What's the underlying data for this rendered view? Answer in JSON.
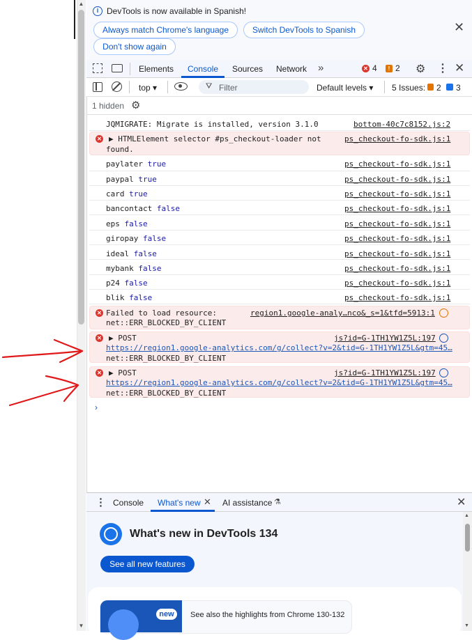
{
  "infobar": {
    "icon": "i",
    "message": "DevTools is now available in Spanish!",
    "btn_match": "Always match Chrome's language",
    "btn_switch": "Switch DevTools to Spanish",
    "btn_dont": "Don't show again",
    "close": "✕"
  },
  "tabs": {
    "elements": "Elements",
    "console": "Console",
    "sources": "Sources",
    "network": "Network",
    "more": "»",
    "error_icon": "✕",
    "error_count": "4",
    "warning_icon": "!",
    "warning_count": "2",
    "settings": "⚙",
    "menu": "⋮",
    "close": "✕"
  },
  "toolbar": {
    "context": "top ▾",
    "filter_icon": "⛛",
    "filter_placeholder": "Filter",
    "levels": "Default levels ▾",
    "issues_label": "5 Issues:",
    "issues_warn": "2",
    "issues_info": "3",
    "hidden": "1 hidden",
    "hidden_gear": "⚙"
  },
  "console_rows": [
    {
      "text": "JQMIGRATE: Migrate is installed, version 3.1.0",
      "source": "bottom-40c7c8152.js:2"
    },
    {
      "text": "▶ HTMLElement selector #ps_checkout-loader not",
      "text2": "found.",
      "source": "ps_checkout-fo-sdk.js:1"
    },
    {
      "text": "paylater",
      "value": "true",
      "source": "ps_checkout-fo-sdk.js:1"
    },
    {
      "text": "paypal",
      "value": "true",
      "source": "ps_checkout-fo-sdk.js:1"
    },
    {
      "text": "card",
      "value": "true",
      "source": "ps_checkout-fo-sdk.js:1"
    },
    {
      "text": "bancontact",
      "value": "false",
      "source": "ps_checkout-fo-sdk.js:1"
    },
    {
      "text": "eps",
      "value": "false",
      "source": "ps_checkout-fo-sdk.js:1"
    },
    {
      "text": "giropay",
      "value": "false",
      "source": "ps_checkout-fo-sdk.js:1"
    },
    {
      "text": "ideal",
      "value": "false",
      "source": "ps_checkout-fo-sdk.js:1"
    },
    {
      "text": "mybank",
      "value": "false",
      "source": "ps_checkout-fo-sdk.js:1"
    },
    {
      "text": "p24",
      "value": "false",
      "source": "ps_checkout-fo-sdk.js:1"
    },
    {
      "text": "blik",
      "value": "false",
      "source": "ps_checkout-fo-sdk.js:1"
    },
    {
      "text": "Failed to load resource:",
      "text2": "net::ERR_BLOCKED_BY_CLIENT",
      "source": "region1.google-analy…nco&_s=1&tfd=5913:1"
    },
    {
      "text": "▶ POST",
      "url": "https://region1.google-analytics.com/g/collect?v=2&tid=G-1TH1YW1Z5L&gtm=45…",
      "text2": "net::ERR_BLOCKED_BY_CLIENT",
      "source": "js?id=G-1TH1YW1Z5L:197"
    },
    {
      "text": "▶ POST",
      "url": "https://region1.google-analytics.com/g/collect?v=2&tid=G-1TH1YW1Z5L&gtm=45…",
      "text2": "net::ERR_BLOCKED_BY_CLIENT",
      "source": "js?id=G-1TH1YW1Z5L:197"
    }
  ],
  "error_icon": "✕",
  "prompt": "›",
  "drawer": {
    "menu": "⋮",
    "tab_console": "Console",
    "tab_whatsnew": "What's new",
    "tab_close": "✕",
    "tab_ai": "AI assistance",
    "flask": "⚗",
    "close": "✕"
  },
  "whats_new": {
    "title": "What's new in DevTools 134",
    "button": "See all new features",
    "badge": "new",
    "card_text": "See also the highlights from Chrome 130-132"
  },
  "scroll": {
    "up": "▲",
    "down": "▼"
  },
  "colors": {
    "accent": "#0b57d0",
    "error": "#dc362e",
    "warning": "#e37400",
    "annotation": "#e0191b"
  }
}
